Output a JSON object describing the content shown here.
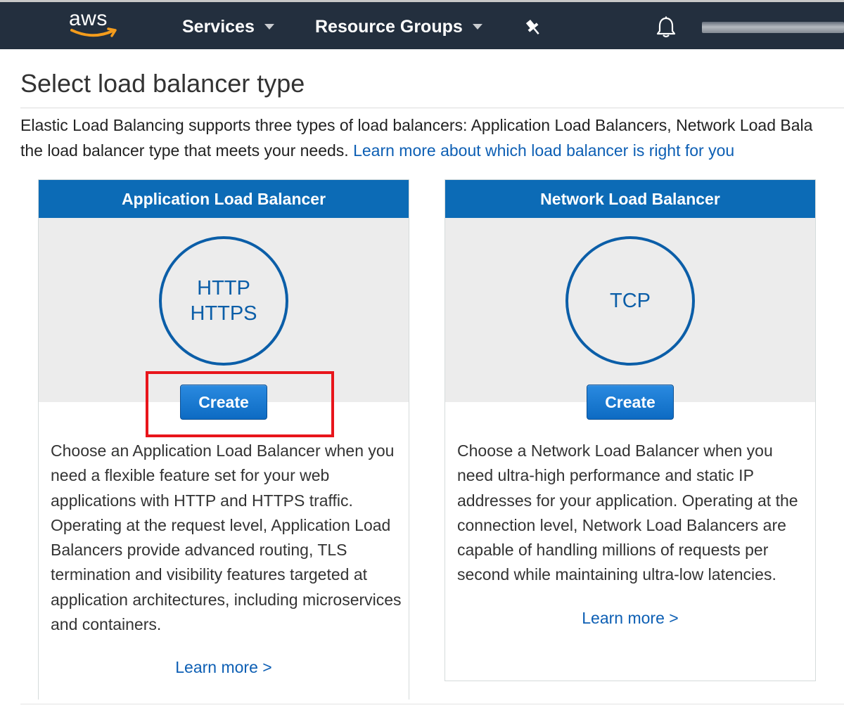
{
  "nav": {
    "services_label": "Services",
    "resource_groups_label": "Resource Groups",
    "logo_text": "aws",
    "colors": {
      "background": "#232f3e",
      "smile": "#f49c1c"
    }
  },
  "page": {
    "title": "Select load balancer type",
    "intro_line1": "Elastic Load Balancing supports three types of load balancers: Application Load Balancers, Network Load Bala",
    "intro_line2": "the load balancer type that meets your needs. ",
    "intro_link": "Learn more about which load balancer is right for you"
  },
  "cards": [
    {
      "title": "Application Load Balancer",
      "protocols": [
        "HTTP",
        "HTTPS"
      ],
      "create_label": "Create",
      "description": "Choose an Application Load Balancer when you need a flexible feature set for your web applications with HTTP and HTTPS traffic. Operating at the request level, Application Load Balancers provide advanced routing, TLS termination and visibility features targeted at application architectures, including microservices and containers.",
      "learn_more": "Learn more >",
      "highlighted": true
    },
    {
      "title": "Network Load Balancer",
      "protocols": [
        "TCP"
      ],
      "create_label": "Create",
      "description": "Choose a Network Load Balancer when you need ultra-high performance and static IP addresses for your application. Operating at the connection level, Network Load Balancers are capable of handling millions of requests per second while maintaining ultra-low latencies.",
      "learn_more": "Learn more >",
      "highlighted": false
    }
  ],
  "colors": {
    "card_header": "#0c6bb6",
    "circle": "#0b5ea8",
    "link": "#0d5fb4",
    "highlight": "#e8151b"
  }
}
